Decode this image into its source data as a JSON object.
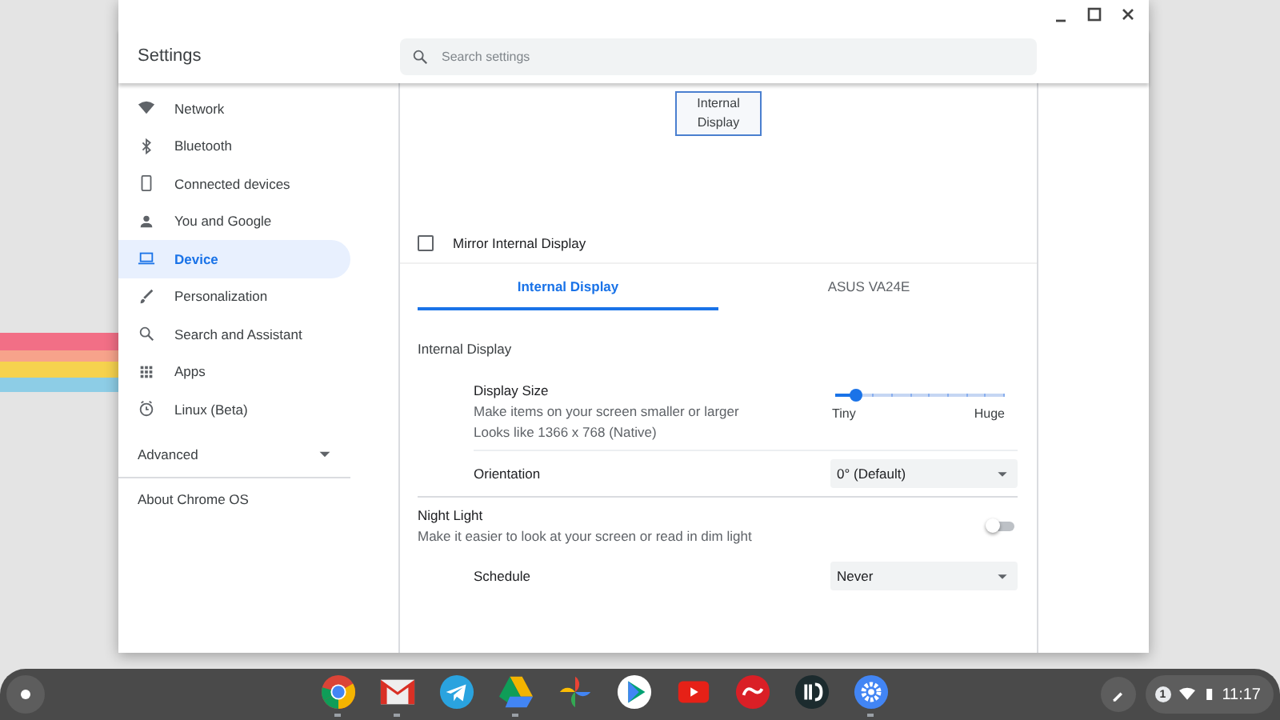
{
  "window": {
    "title": "Settings",
    "search": {
      "placeholder": "Search settings"
    }
  },
  "sidebar": {
    "items": [
      {
        "label": "Network",
        "selected": false
      },
      {
        "label": "Bluetooth",
        "selected": false
      },
      {
        "label": "Connected devices",
        "selected": false
      },
      {
        "label": "You and Google",
        "selected": false
      },
      {
        "label": "Device",
        "selected": true
      },
      {
        "label": "Personalization",
        "selected": false
      },
      {
        "label": "Search and Assistant",
        "selected": false
      },
      {
        "label": "Apps",
        "selected": false
      },
      {
        "label": "Linux (Beta)",
        "selected": false
      }
    ],
    "advanced": {
      "label": "Advanced",
      "expanded": false
    },
    "about": "About Chrome OS"
  },
  "displays": [
    {
      "label": "Internal Display",
      "selected": true
    }
  ],
  "mirror": {
    "label": "Mirror Internal Display",
    "checked": false
  },
  "tabs": [
    {
      "label": "Internal Display",
      "selected": true
    },
    {
      "label": "ASUS VA24E",
      "selected": false
    }
  ],
  "rows": [
    {
      "kind": "heading",
      "title": "Internal Display",
      "children": [
        {
          "kind": "slider",
          "title": "Display Size",
          "description": "Make items on your screen smaller or larger",
          "detail": "Looks like 1366 x 768 (Native)",
          "level": 0.12,
          "min_label": "Tiny",
          "max_label": "Huge"
        },
        {
          "kind": "dropdown",
          "title": "Orientation",
          "value": "0° (Default)"
        }
      ]
    },
    {
      "kind": "toggle",
      "title": "Night Light",
      "description": "Make it easier to look at your screen or read in dim light",
      "on": false,
      "children": [
        {
          "kind": "dropdown",
          "title": "Schedule",
          "value": "Never"
        }
      ]
    }
  ],
  "shelf": {
    "apps": [
      {
        "running": true
      },
      {
        "running": true
      },
      {
        "running": false
      },
      {
        "running": true
      },
      {
        "running": false
      },
      {
        "running": false
      },
      {
        "running": false
      },
      {
        "running": false
      },
      {
        "running": false
      },
      {
        "running": true
      }
    ],
    "status": {
      "notifications": "1",
      "time": "11:17"
    }
  }
}
